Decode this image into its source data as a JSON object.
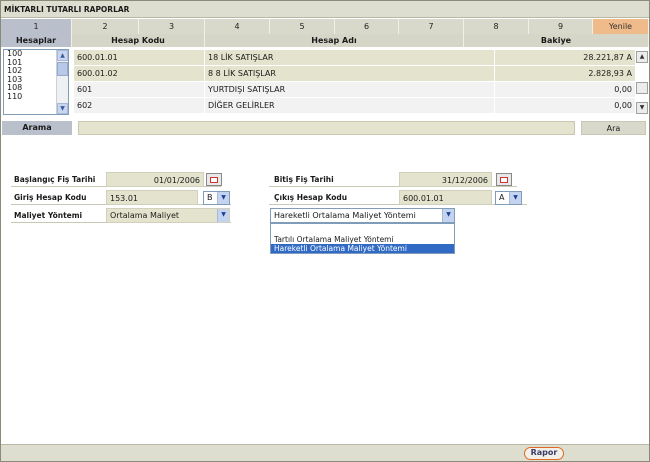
{
  "window": {
    "title": "MİKTARLI TUTARLI RAPORLAR"
  },
  "tabs": [
    "1",
    "2",
    "3",
    "4",
    "5",
    "6",
    "7",
    "8",
    "9"
  ],
  "refresh_label": "Yenile",
  "columns": {
    "hesaplar": "Hesaplar",
    "hesap_kodu": "Hesap Kodu",
    "hesap_adi": "Hesap Adı",
    "bakiye": "Bakiye"
  },
  "account_list": [
    "100",
    "101",
    "102",
    "103",
    "108",
    "110"
  ],
  "rows": [
    {
      "kod": "600.01.01",
      "ad": "18 LİK SATIŞLAR",
      "bakiye": "28.221,87 A"
    },
    {
      "kod": "600.01.02",
      "ad": "8 8 LİK SATIŞLAR",
      "bakiye": "2.828,93 A"
    },
    {
      "kod": "601",
      "ad": "YURTDIŞI SATIŞLAR",
      "bakiye": "0,00"
    },
    {
      "kod": "602",
      "ad": "DİĞER GELİRLER",
      "bakiye": "0,00"
    }
  ],
  "search": {
    "label": "Arama",
    "value": "",
    "button": "Ara"
  },
  "form": {
    "baslangic_label": "Başlangıç Fiş Tarihi",
    "baslangic_value": "01/01/2006",
    "bitis_label": "Bitiş Fiş Tarihi",
    "bitis_value": "31/12/2006",
    "giris_label": "Giriş Hesap Kodu",
    "giris_value": "153.01",
    "giris_type": "B",
    "cikis_label": "Çıkış Hesap Kodu",
    "cikis_value": "600.01.01",
    "cikis_type": "A",
    "maliyet_label": "Maliyet Yöntemi",
    "maliyet_value": "Ortalama Maliyet",
    "yontem_value": "Hareketli Ortalama Maliyet Yöntemi",
    "yontem_options": [
      "Tartılı Ortalama Maliyet Yöntemi",
      "Hareketli Ortalama Maliyet Yöntemi"
    ]
  },
  "footer": {
    "rapor_label": "Rapor"
  },
  "colors": {
    "accent": "#316ac5",
    "panel": "#deded0",
    "field": "#e4e4ce",
    "refresh": "#f0bb8a",
    "rapor_border": "#e06a20"
  }
}
